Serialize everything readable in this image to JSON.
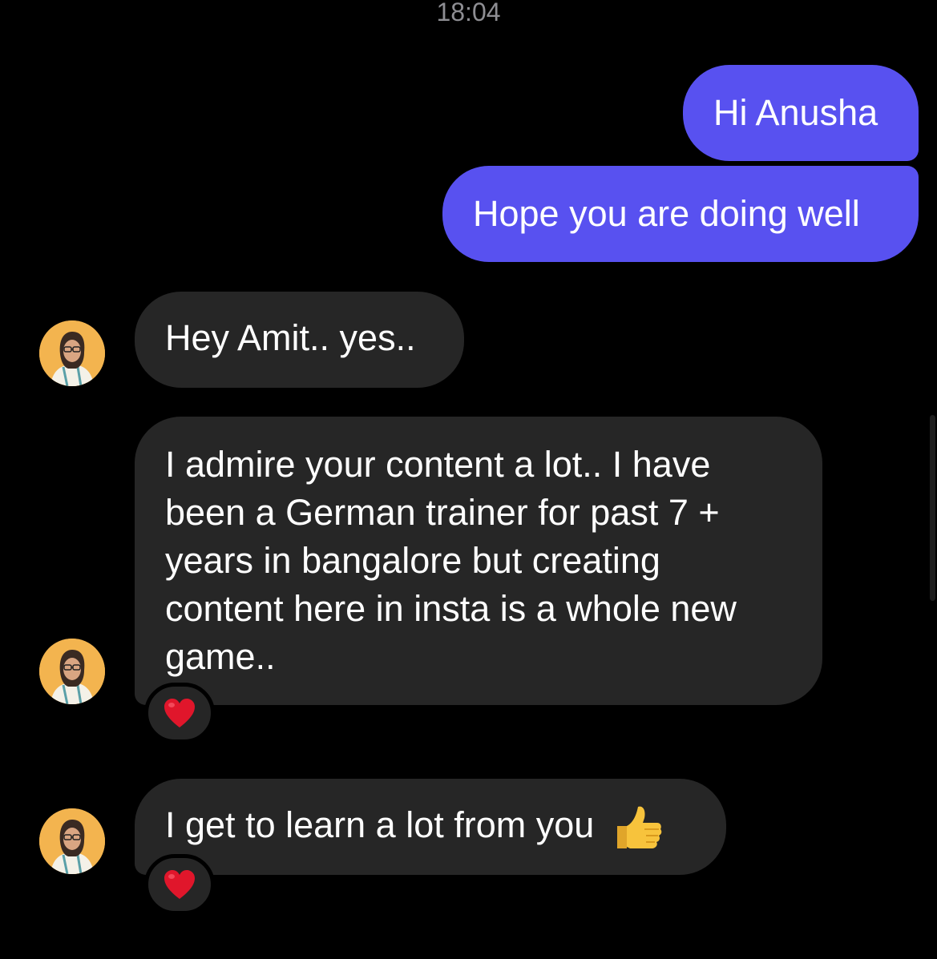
{
  "conversation": {
    "timestamp": "18:04",
    "messages": [
      {
        "id": "m1",
        "direction": "sent",
        "text": "Hi Anusha"
      },
      {
        "id": "m2",
        "direction": "sent",
        "text": "Hope you are doing well"
      },
      {
        "id": "m3",
        "direction": "received",
        "text": "Hey Amit.. yes.."
      },
      {
        "id": "m4",
        "direction": "received",
        "lines": [
          "I admire your content a lot.. I have",
          "been a German trainer for past 7 +",
          "years in bangalore but creating",
          "content here in insta is a whole new",
          "game.."
        ],
        "reaction": "heart-icon"
      },
      {
        "id": "m5",
        "direction": "received",
        "text": "I get to learn a lot from you",
        "emoji": "thumbs-up-icon",
        "reaction": "heart-icon"
      }
    ]
  },
  "colors": {
    "background": "#000000",
    "sent_bubble": "#5851f0",
    "received_bubble": "#262626",
    "timestamp_text": "#8e8e93",
    "avatar_bg": "#f3b44f",
    "heart": "#e0162b",
    "thumb": "#f7c33c"
  }
}
